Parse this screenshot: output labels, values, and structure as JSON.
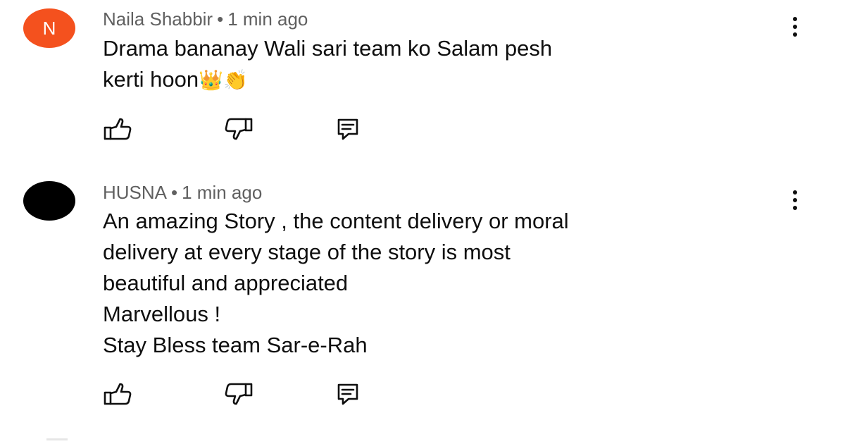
{
  "comments": [
    {
      "avatar_letter": "N",
      "author": "Naila Shabbir",
      "separator": "•",
      "time": "1 min ago",
      "lines": [
        "Drama bananay Wali sari team ko Salam pesh",
        "kerti hoon"
      ],
      "emojis": "👑👏",
      "avatar_color": "#f4511e"
    },
    {
      "author": "HUSNA",
      "separator": "•",
      "time": "1 min ago",
      "lines": [
        "An amazing Story , the content delivery or moral",
        "delivery at every stage of the story is most",
        "beautiful and appreciated",
        "Marvellous !",
        "Stay Bless team Sar-e-Rah"
      ],
      "avatar_color": "#000000"
    }
  ],
  "icons": {
    "like": "thumbs-up-icon",
    "dislike": "thumbs-down-icon",
    "reply": "comment-reply-icon",
    "more": "more-vertical-icon"
  },
  "colors": {
    "meta_text": "#606060",
    "body_text": "#0f0f0f"
  }
}
